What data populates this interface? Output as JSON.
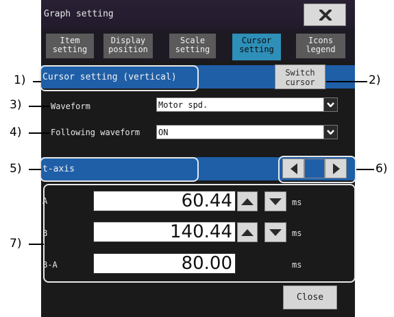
{
  "window": {
    "title": "Graph setting",
    "close_icon": "close-x-icon"
  },
  "tabs": [
    {
      "label": "Item\nsetting",
      "active": false
    },
    {
      "label": "Display\nposition",
      "active": false
    },
    {
      "label": "Scale\nsetting",
      "active": false
    },
    {
      "label": "Cursor\nsetting",
      "active": true
    },
    {
      "label": "Icons\nlegend",
      "active": false
    }
  ],
  "cursor_section": {
    "label": "Cursor setting (vertical)",
    "switch_label": "Switch\ncursor"
  },
  "waveform": {
    "label": "Waveform",
    "value": "Motor spd."
  },
  "following": {
    "label": "Following waveform",
    "value": "ON"
  },
  "axis": {
    "label": "t-axis"
  },
  "cursors": [
    {
      "name": "A",
      "value": "60.44",
      "unit": "ms",
      "has_stepper": true
    },
    {
      "name": "B",
      "value": "140.44",
      "unit": "ms",
      "has_stepper": true
    },
    {
      "name": "B-A",
      "value": "80.00",
      "unit": "ms",
      "has_stepper": false
    }
  ],
  "footer": {
    "close_label": "Close"
  },
  "callouts": [
    "1)",
    "2)",
    "3)",
    "4)",
    "5)",
    "6)",
    "7)"
  ],
  "colors": {
    "band_blue": "#1f5fa8",
    "active_tab": "#2e8fb8",
    "background": "#1a1a1a"
  }
}
